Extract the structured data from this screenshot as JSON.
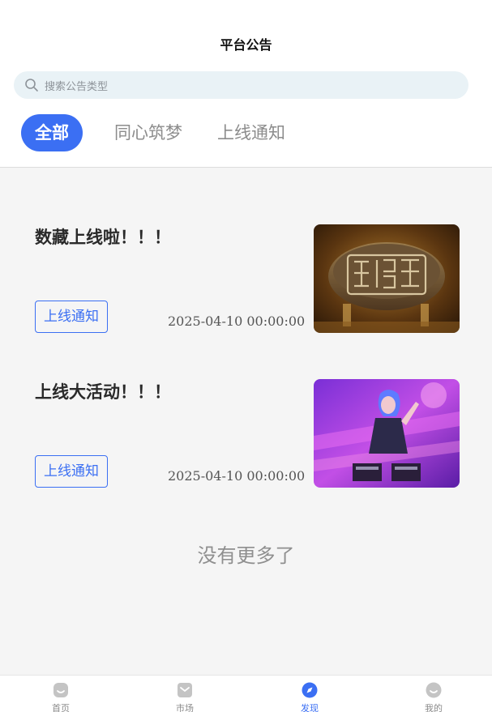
{
  "header": {
    "title": "平台公告"
  },
  "search": {
    "placeholder": "搜索公告类型"
  },
  "tabs": [
    {
      "label": "全部",
      "active": true
    },
    {
      "label": "同心筑梦",
      "active": false
    },
    {
      "label": "上线通知",
      "active": false
    }
  ],
  "announcements": [
    {
      "title": "数藏上线啦！！！",
      "tag": "上线通知",
      "date": "2025-04-10 00:00:00",
      "image_icon": "bronze-seal-image"
    },
    {
      "title": "上线大活动！！！",
      "tag": "上线通知",
      "date": "2025-04-10 00:00:00",
      "image_icon": "cyber-girl-image"
    }
  ],
  "footer_text": "没有更多了",
  "bottom_nav": [
    {
      "label": "首页",
      "icon": "home-icon",
      "active": false
    },
    {
      "label": "市场",
      "icon": "market-icon",
      "active": false
    },
    {
      "label": "发现",
      "icon": "compass-icon",
      "active": true
    },
    {
      "label": "我的",
      "icon": "profile-icon",
      "active": false
    }
  ],
  "colors": {
    "accent": "#3b6ff3",
    "search_bg": "#e9f2f6",
    "page_bg": "#f5f5f5"
  }
}
